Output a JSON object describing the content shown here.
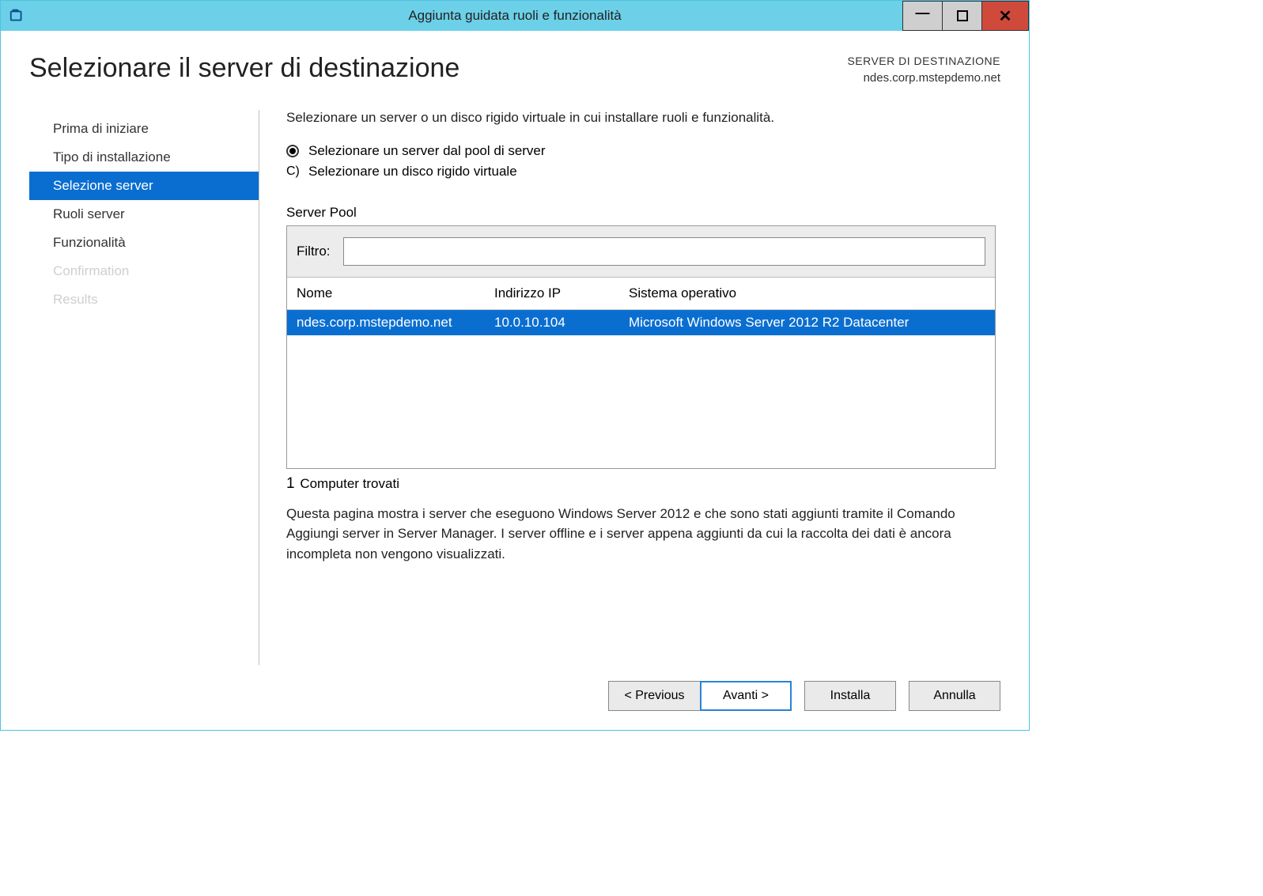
{
  "window": {
    "title": "Aggiunta guidata ruoli e funzionalità"
  },
  "header": {
    "page_title": "Selezionare il server di destinazione",
    "dest_label": "SERVER DI DESTINAZIONE",
    "dest_server": "ndes.corp.mstepdemo.net"
  },
  "sidebar": {
    "items": [
      {
        "label": "Prima di iniziare",
        "state": "normal"
      },
      {
        "label": "Tipo di installazione",
        "state": "normal"
      },
      {
        "label": "Selezione server",
        "state": "selected"
      },
      {
        "label": "Ruoli server",
        "state": "normal"
      },
      {
        "label": "Funzionalità",
        "state": "normal"
      },
      {
        "label": "Confirmation",
        "state": "disabled"
      },
      {
        "label": "Results",
        "state": "disabled"
      }
    ]
  },
  "main": {
    "intro": "Selezionare un server o un disco rigido virtuale in cui installare ruoli e funzionalità.",
    "radio1": "Selezionare un server dal pool di server",
    "radio2_prefix": "C)",
    "radio2": "Selezionare un disco rigido virtuale",
    "pool_label": "Server Pool",
    "filter_label": "Filtro:",
    "filter_value": "",
    "columns": {
      "name": "Nome",
      "ip": "Indirizzo IP",
      "os": "Sistema operativo"
    },
    "rows": [
      {
        "name": "ndes.corp.mstepdemo.net",
        "ip": "10.0.10.104",
        "os": "Microsoft Windows Server 2012 R2 Datacenter"
      }
    ],
    "count_num": "1",
    "count_label": "Computer trovati",
    "help": "Questa pagina mostra i server che eseguono Windows Server 2012 e che sono stati aggiunti tramite il Comando Aggiungi server in Server Manager. I server offline e i server appena aggiunti da cui la raccolta dei dati è ancora incompleta non vengono visualizzati."
  },
  "footer": {
    "prev": "< Previous",
    "next": "Avanti >",
    "install": "Installa",
    "cancel": "Annulla"
  }
}
